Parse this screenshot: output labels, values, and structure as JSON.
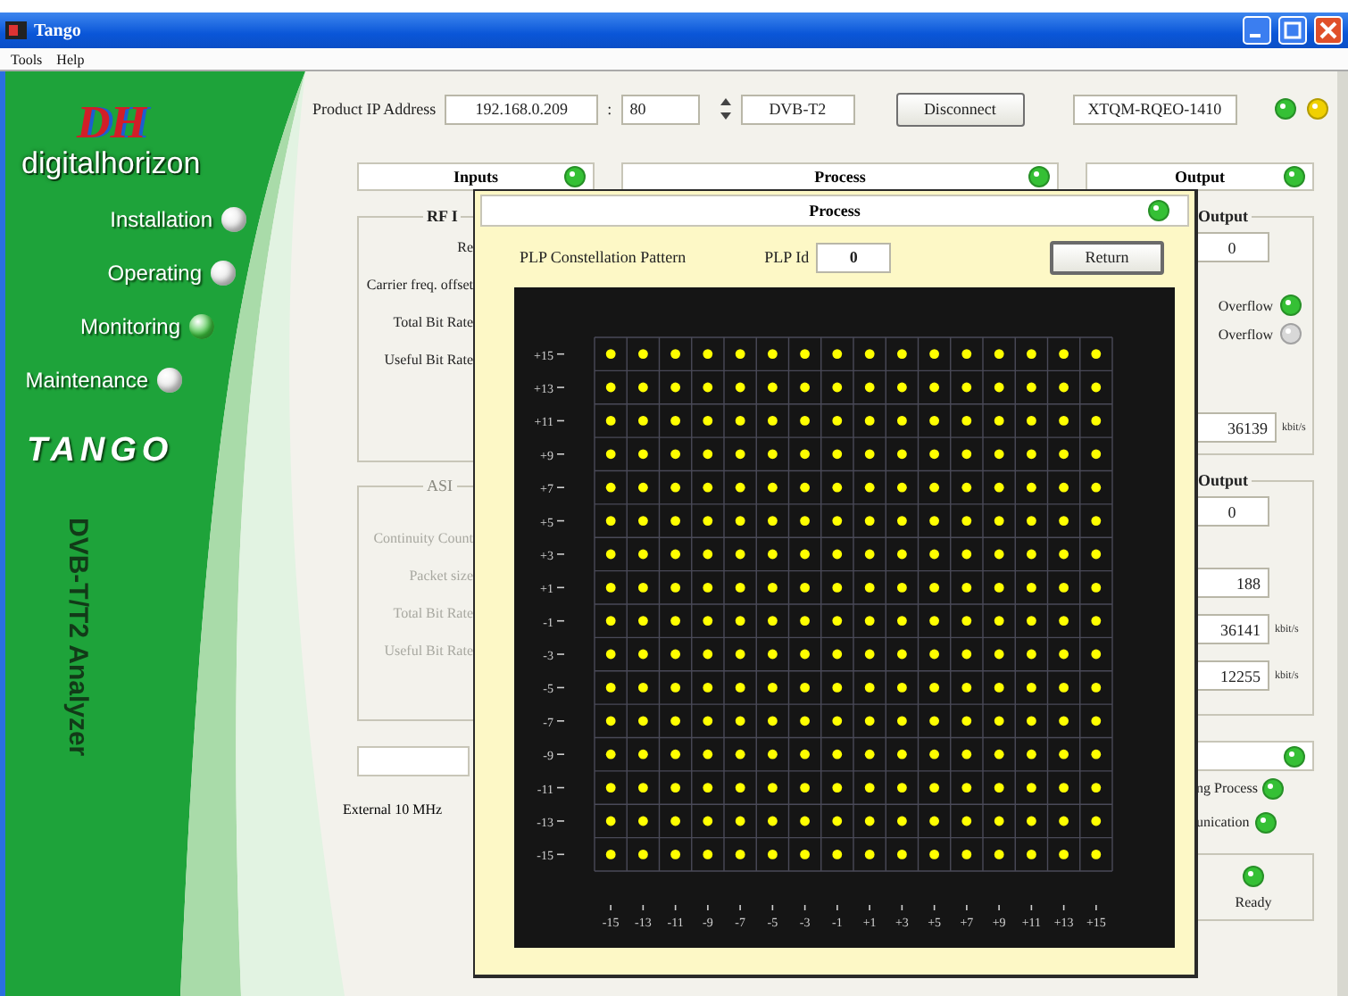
{
  "window": {
    "title": "Tango"
  },
  "menu": [
    "Tools",
    "Help"
  ],
  "sidebar": {
    "logo": "DH",
    "brand": "digitalhorizon",
    "items": [
      {
        "label": "Installation",
        "selected": false
      },
      {
        "label": "Operating",
        "selected": false
      },
      {
        "label": "Monitoring",
        "selected": true
      },
      {
        "label": "Maintenance",
        "selected": false
      }
    ],
    "product": "TANGO",
    "subtitle": "DVB-T/T2 Analyzer"
  },
  "connection": {
    "ip_label": "Product IP Address",
    "ip": "192.168.0.209",
    "separator": ":",
    "port": "80",
    "standard": "DVB-T2",
    "button": "Disconnect",
    "serial": "XTQM-RQEO-1410",
    "indicators": [
      {
        "color": "#35c035"
      },
      {
        "color": "#f0d000"
      }
    ]
  },
  "inputs": {
    "title": "Inputs",
    "indicator": {
      "color": "#35c035"
    },
    "rf_group": {
      "title": "RF I",
      "fields": [
        "Re",
        "Carrier freq. offset",
        "Total Bit Rate",
        "Useful Bit Rate"
      ]
    },
    "asi_group": {
      "title": "ASI",
      "disabled": true,
      "fields": [
        "Continuity Count",
        "Packet size",
        "Total Bit Rate",
        "Useful Bit Rate"
      ]
    },
    "clock_label": "External 10 MHz"
  },
  "process": {
    "title": "Process",
    "indicator": {
      "color": "#35c035"
    }
  },
  "output": {
    "title": "Output",
    "indicator": {
      "color": "#35c035"
    },
    "group1": {
      "title": "Output",
      "value": "0",
      "flags": [
        {
          "label": "Overflow",
          "color": "#35c035"
        },
        {
          "label": "Overflow",
          "color": "#d8d8d8"
        }
      ],
      "bitrate": "36139",
      "unit": "kbit/s"
    },
    "group2": {
      "title": "Output",
      "values": [
        {
          "value": "0"
        },
        {
          "value": "188"
        },
        {
          "value": "36141",
          "unit": "kbit/s"
        },
        {
          "value": "12255",
          "unit": "kbit/s"
        }
      ]
    },
    "status": {
      "indicator": {
        "color": "#35c035"
      },
      "items": [
        {
          "label": "ng Process",
          "color": "#35c035"
        },
        {
          "label": "unication",
          "color": "#35c035"
        }
      ],
      "ready": {
        "label": "Ready",
        "color": "#35c035"
      }
    }
  },
  "dialog": {
    "title": "Process",
    "indicator": {
      "color": "#35c035"
    },
    "heading": "PLP Constellation Pattern",
    "plp_label": "PLP Id",
    "plp_id": "0",
    "button": "Return",
    "chart_data": {
      "type": "scatter",
      "xlim": [
        -16,
        16
      ],
      "ylim": [
        -16,
        16
      ],
      "xticks": [
        {
          "value": -15,
          "label": "-15"
        },
        {
          "value": -13,
          "label": "-13"
        },
        {
          "value": -11,
          "label": "-11"
        },
        {
          "value": -9,
          "label": "-9"
        },
        {
          "value": -7,
          "label": "-7"
        },
        {
          "value": -5,
          "label": "-5"
        },
        {
          "value": -3,
          "label": "-3"
        },
        {
          "value": -1,
          "label": "-1"
        },
        {
          "value": 1,
          "label": "+1"
        },
        {
          "value": 3,
          "label": "+3"
        },
        {
          "value": 5,
          "label": "+5"
        },
        {
          "value": 7,
          "label": "+7"
        },
        {
          "value": 9,
          "label": "+9"
        },
        {
          "value": 11,
          "label": "+11"
        },
        {
          "value": 13,
          "label": "+13"
        },
        {
          "value": 15,
          "label": "+15"
        }
      ],
      "yticks": [
        {
          "value": 15,
          "label": "+15"
        },
        {
          "value": 13,
          "label": "+13"
        },
        {
          "value": 11,
          "label": "+11"
        },
        {
          "value": 9,
          "label": "+9"
        },
        {
          "value": 7,
          "label": "+7"
        },
        {
          "value": 5,
          "label": "+5"
        },
        {
          "value": 3,
          "label": "+3"
        },
        {
          "value": 1,
          "label": "+1"
        },
        {
          "value": -1,
          "label": "-1"
        },
        {
          "value": -3,
          "label": "-3"
        },
        {
          "value": -5,
          "label": "-5"
        },
        {
          "value": -7,
          "label": "-7"
        },
        {
          "value": -9,
          "label": "-9"
        },
        {
          "value": -11,
          "label": "-11"
        },
        {
          "value": -13,
          "label": "-13"
        },
        {
          "value": -15,
          "label": "-15"
        }
      ],
      "x": [
        -15,
        -13,
        -11,
        -9,
        -7,
        -5,
        -3,
        -1,
        1,
        3,
        5,
        7,
        9,
        11,
        13,
        15,
        -15,
        -13,
        -11,
        -9,
        -7,
        -5,
        -3,
        -1,
        1,
        3,
        5,
        7,
        9,
        11,
        13,
        15,
        -15,
        -13,
        -11,
        -9,
        -7,
        -5,
        -3,
        -1,
        1,
        3,
        5,
        7,
        9,
        11,
        13,
        15,
        -15,
        -13,
        -11,
        -9,
        -7,
        -5,
        -3,
        -1,
        1,
        3,
        5,
        7,
        9,
        11,
        13,
        15,
        -15,
        -13,
        -11,
        -9,
        -7,
        -5,
        -3,
        -1,
        1,
        3,
        5,
        7,
        9,
        11,
        13,
        15,
        -15,
        -13,
        -11,
        -9,
        -7,
        -5,
        -3,
        -1,
        1,
        3,
        5,
        7,
        9,
        11,
        13,
        15,
        -15,
        -13,
        -11,
        -9,
        -7,
        -5,
        -3,
        -1,
        1,
        3,
        5,
        7,
        9,
        11,
        13,
        15,
        -15,
        -13,
        -11,
        -9,
        -7,
        -5,
        -3,
        -1,
        1,
        3,
        5,
        7,
        9,
        11,
        13,
        15,
        -15,
        -13,
        -11,
        -9,
        -7,
        -5,
        -3,
        -1,
        1,
        3,
        5,
        7,
        9,
        11,
        13,
        15,
        -15,
        -13,
        -11,
        -9,
        -7,
        -5,
        -3,
        -1,
        1,
        3,
        5,
        7,
        9,
        11,
        13,
        15,
        -15,
        -13,
        -11,
        -9,
        -7,
        -5,
        -3,
        -1,
        1,
        3,
        5,
        7,
        9,
        11,
        13,
        15,
        -15,
        -13,
        -11,
        -9,
        -7,
        -5,
        -3,
        -1,
        1,
        3,
        5,
        7,
        9,
        11,
        13,
        15,
        -15,
        -13,
        -11,
        -9,
        -7,
        -5,
        -3,
        -1,
        1,
        3,
        5,
        7,
        9,
        11,
        13,
        15,
        -15,
        -13,
        -11,
        -9,
        -7,
        -5,
        -3,
        -1,
        1,
        3,
        5,
        7,
        9,
        11,
        13,
        15,
        -15,
        -13,
        -11,
        -9,
        -7,
        -5,
        -3,
        -1,
        1,
        3,
        5,
        7,
        9,
        11,
        13,
        15,
        -15,
        -13,
        -11,
        -9,
        -7,
        -5,
        -3,
        -1,
        1,
        3,
        5,
        7,
        9,
        11,
        13,
        15
      ],
      "series": [
        {
          "color": "#ffff00",
          "values": [
            15,
            15,
            15,
            15,
            15,
            15,
            15,
            15,
            15,
            15,
            15,
            15,
            15,
            15,
            15,
            15,
            13,
            13,
            13,
            13,
            13,
            13,
            13,
            13,
            13,
            13,
            13,
            13,
            13,
            13,
            13,
            13,
            11,
            11,
            11,
            11,
            11,
            11,
            11,
            11,
            11,
            11,
            11,
            11,
            11,
            11,
            11,
            11,
            9,
            9,
            9,
            9,
            9,
            9,
            9,
            9,
            9,
            9,
            9,
            9,
            9,
            9,
            9,
            9,
            7,
            7,
            7,
            7,
            7,
            7,
            7,
            7,
            7,
            7,
            7,
            7,
            7,
            7,
            7,
            7,
            5,
            5,
            5,
            5,
            5,
            5,
            5,
            5,
            5,
            5,
            5,
            5,
            5,
            5,
            5,
            5,
            3,
            3,
            3,
            3,
            3,
            3,
            3,
            3,
            3,
            3,
            3,
            3,
            3,
            3,
            3,
            3,
            1,
            1,
            1,
            1,
            1,
            1,
            1,
            1,
            1,
            1,
            1,
            1,
            1,
            1,
            1,
            1,
            -1,
            -1,
            -1,
            -1,
            -1,
            -1,
            -1,
            -1,
            -1,
            -1,
            -1,
            -1,
            -1,
            -1,
            -1,
            -1,
            -3,
            -3,
            -3,
            -3,
            -3,
            -3,
            -3,
            -3,
            -3,
            -3,
            -3,
            -3,
            -3,
            -3,
            -3,
            -3,
            -5,
            -5,
            -5,
            -5,
            -5,
            -5,
            -5,
            -5,
            -5,
            -5,
            -5,
            -5,
            -5,
            -5,
            -5,
            -5,
            -7,
            -7,
            -7,
            -7,
            -7,
            -7,
            -7,
            -7,
            -7,
            -7,
            -7,
            -7,
            -7,
            -7,
            -7,
            -7,
            -9,
            -9,
            -9,
            -9,
            -9,
            -9,
            -9,
            -9,
            -9,
            -9,
            -9,
            -9,
            -9,
            -9,
            -9,
            -9,
            -11,
            -11,
            -11,
            -11,
            -11,
            -11,
            -11,
            -11,
            -11,
            -11,
            -11,
            -11,
            -11,
            -11,
            -11,
            -11,
            -13,
            -13,
            -13,
            -13,
            -13,
            -13,
            -13,
            -13,
            -13,
            -13,
            -13,
            -13,
            -13,
            -13,
            -13,
            -13,
            -15,
            -15,
            -15,
            -15,
            -15,
            -15,
            -15,
            -15,
            -15,
            -15,
            -15,
            -15,
            -15,
            -15,
            -15,
            -15
          ]
        }
      ]
    }
  }
}
